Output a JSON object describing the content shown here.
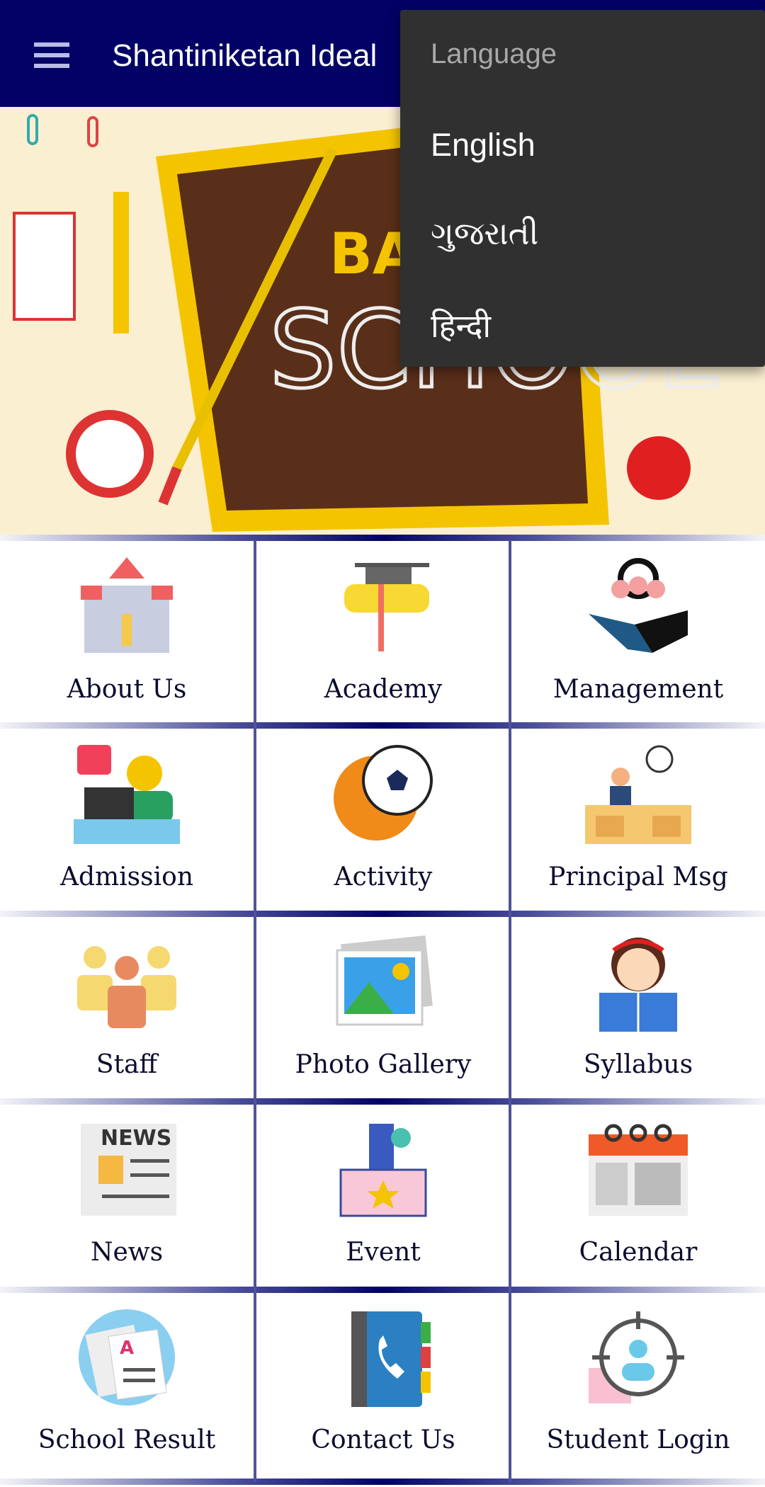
{
  "appbar": {
    "title": "Shantiniketan Ideal",
    "menu_icon": "hamburger-icon",
    "color": "#020266"
  },
  "banner": {
    "line1": "BACK TO",
    "line2": "SCHOOL"
  },
  "grid": [
    {
      "label": "About Us",
      "icon": "school-building-icon"
    },
    {
      "label": "Academy",
      "icon": "graduation-diploma-icon"
    },
    {
      "label": "Management",
      "icon": "handshake-team-icon"
    },
    {
      "label": "Admission",
      "icon": "admission-desk-icon"
    },
    {
      "label": "Activity",
      "icon": "football-icon"
    },
    {
      "label": "Principal Msg",
      "icon": "principal-desk-icon"
    },
    {
      "label": "Staff",
      "icon": "staff-people-icon"
    },
    {
      "label": "Photo Gallery",
      "icon": "photo-gallery-icon"
    },
    {
      "label": "Syllabus",
      "icon": "reading-girl-icon"
    },
    {
      "label": "News",
      "icon": "newspaper-icon"
    },
    {
      "label": "Event",
      "icon": "event-box-icon"
    },
    {
      "label": "Calendar",
      "icon": "calendar-icon"
    },
    {
      "label": "School Result",
      "icon": "result-sheet-icon"
    },
    {
      "label": "Contact Us",
      "icon": "phone-book-icon"
    },
    {
      "label": "Student Login",
      "icon": "student-target-icon"
    }
  ],
  "language_menu": {
    "header": "Language",
    "items": [
      "English",
      "ગુજરાતી",
      "हिन्दी"
    ],
    "background": "#303030"
  }
}
